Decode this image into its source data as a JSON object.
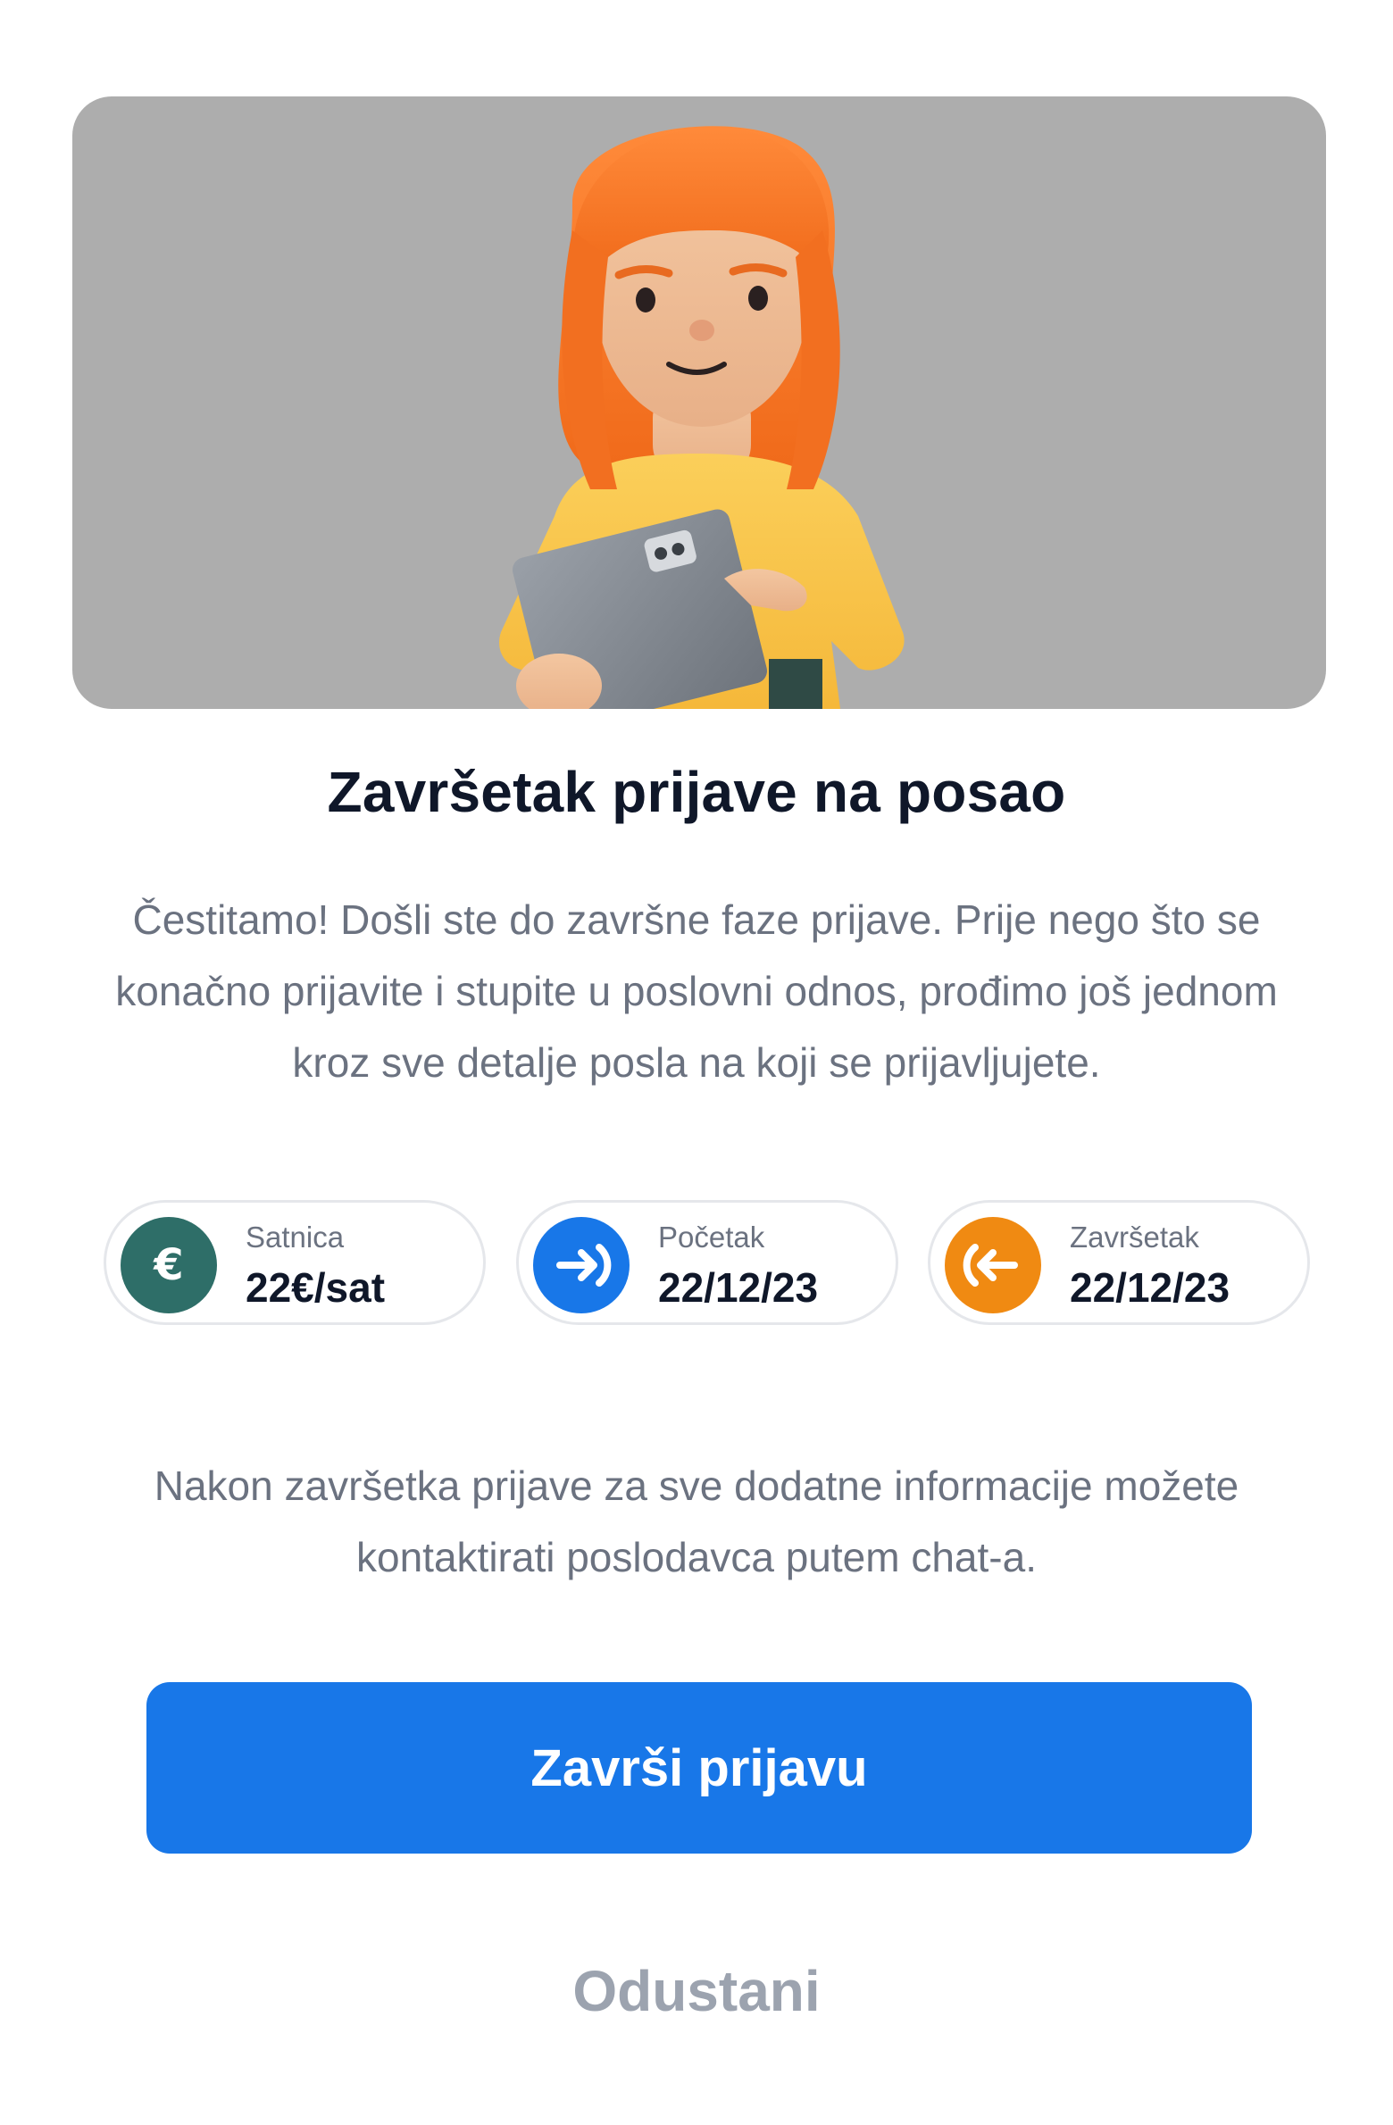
{
  "hero": {
    "background": "#adadad",
    "illustration": "woman-with-tablet-illustration"
  },
  "title": "Završetak prijave na posao",
  "intro": "Čestitamo! Došli ste do završne faze prijave. Prije nego što se konačno prijavite i stupite u poslovni odnos, prođimo još jednom kroz sve detalje posla na koji se prijavljujete.",
  "pills": [
    {
      "label": "Satnica",
      "value": "22€/sat",
      "icon": "euro-icon",
      "color": "#2e6e68"
    },
    {
      "label": "Početak",
      "value": "22/12/23",
      "icon": "arrow-in-icon",
      "color": "#1877e8"
    },
    {
      "label": "Završetak",
      "value": "22/12/23",
      "icon": "arrow-out-icon",
      "color": "#f08a12"
    }
  ],
  "note": "Nakon završetka prijave za sve dodatne informacije možete kontaktirati poslodavca putem chat-a.",
  "buttons": {
    "primary_label": "Završi prijavu",
    "primary_color": "#1877e8",
    "secondary_label": "Odustani"
  }
}
